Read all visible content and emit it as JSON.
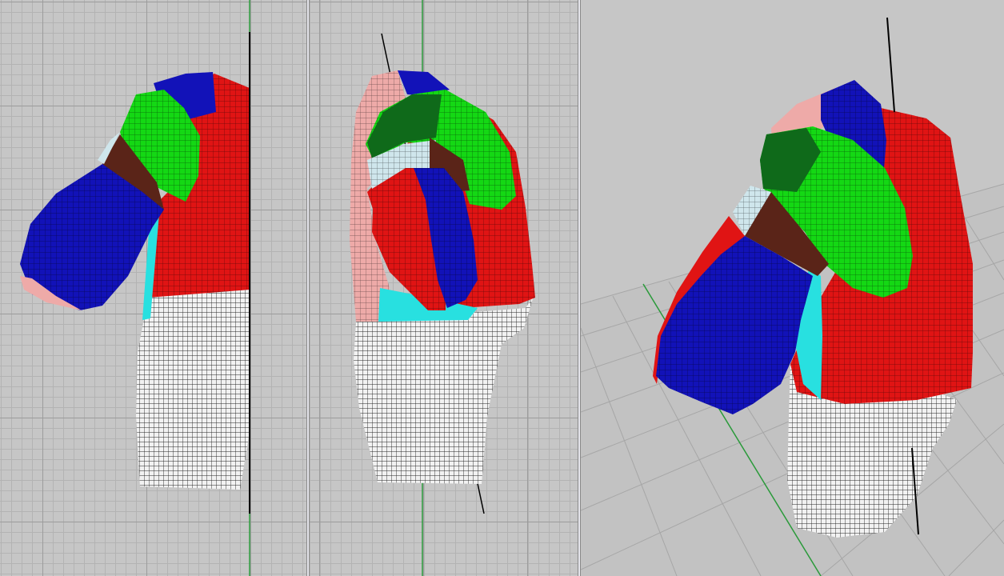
{
  "viewports": [
    {
      "name": "front-view",
      "kind": "orthographic"
    },
    {
      "name": "side-view",
      "kind": "orthographic"
    },
    {
      "name": "perspective-view",
      "kind": "perspective"
    }
  ],
  "colors": {
    "background": "#c6c6c6",
    "grid_minor": "#b3b3b3",
    "grid_major": "#9c9c9c",
    "axis_green": "#2a9a3a",
    "axis_black": "#000000",
    "patch_red": "#e01414",
    "patch_blue": "#1212b8",
    "patch_green": "#14d814",
    "patch_pink": "#eeaaa8",
    "patch_cyan": "#28e0e0",
    "patch_brown": "#5a2418",
    "patch_lightblue": "#cfe6ec",
    "mesh_white": "#f2f2f2",
    "wire": "#1a1a1a"
  }
}
